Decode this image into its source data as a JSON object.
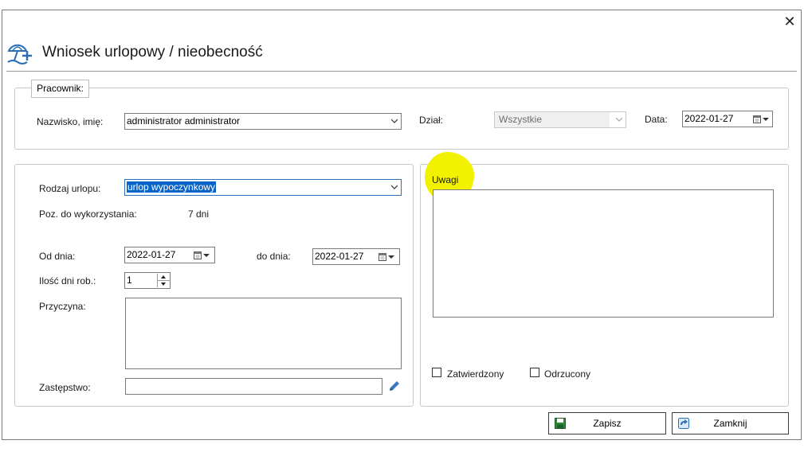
{
  "window": {
    "title": "Wniosek urlopowy / nieobecność",
    "close_label": "✕"
  },
  "employee_group": {
    "tab_label": "Pracownik:",
    "name_label": "Nazwisko, imię:",
    "name_value": "administrator administrator",
    "department_label": "Dział:",
    "department_value": "Wszystkie",
    "date_label": "Data:",
    "date_value": "2022-01-27"
  },
  "leave_group": {
    "leave_type_label": "Rodzaj urlopu:",
    "leave_type_value": "urlop wypoczynkowy",
    "remaining_label": "Poz. do wykorzystania:",
    "remaining_value": "7 dni",
    "from_label": "Od dnia:",
    "from_value": "2022-01-27",
    "to_label": "do dnia:",
    "to_value": "2022-01-27",
    "workdays_label": "Ilość dni rob.:",
    "workdays_value": "1",
    "reason_label": "Przyczyna:",
    "substitute_label": "Zastępstwo:",
    "substitute_value": ""
  },
  "notes_group": {
    "notes_label": "Uwagi",
    "approved_label": "Zatwierdzony",
    "approved_checked": false,
    "rejected_label": "Odrzucony",
    "rejected_checked": false
  },
  "buttons": {
    "save_label": "Zapisz",
    "close_label": "Zamknij"
  },
  "colors": {
    "accent": "#0a64c8",
    "highlight": "#f2f200",
    "save_icon": "#2f8a3c",
    "close_icon": "#2a6fb8"
  },
  "icons": {
    "app": "beach-umbrella-plus-icon",
    "calendar": "calendar-icon",
    "edit": "pencil-icon",
    "save": "floppy-disk-icon",
    "close": "exit-arrow-icon"
  }
}
